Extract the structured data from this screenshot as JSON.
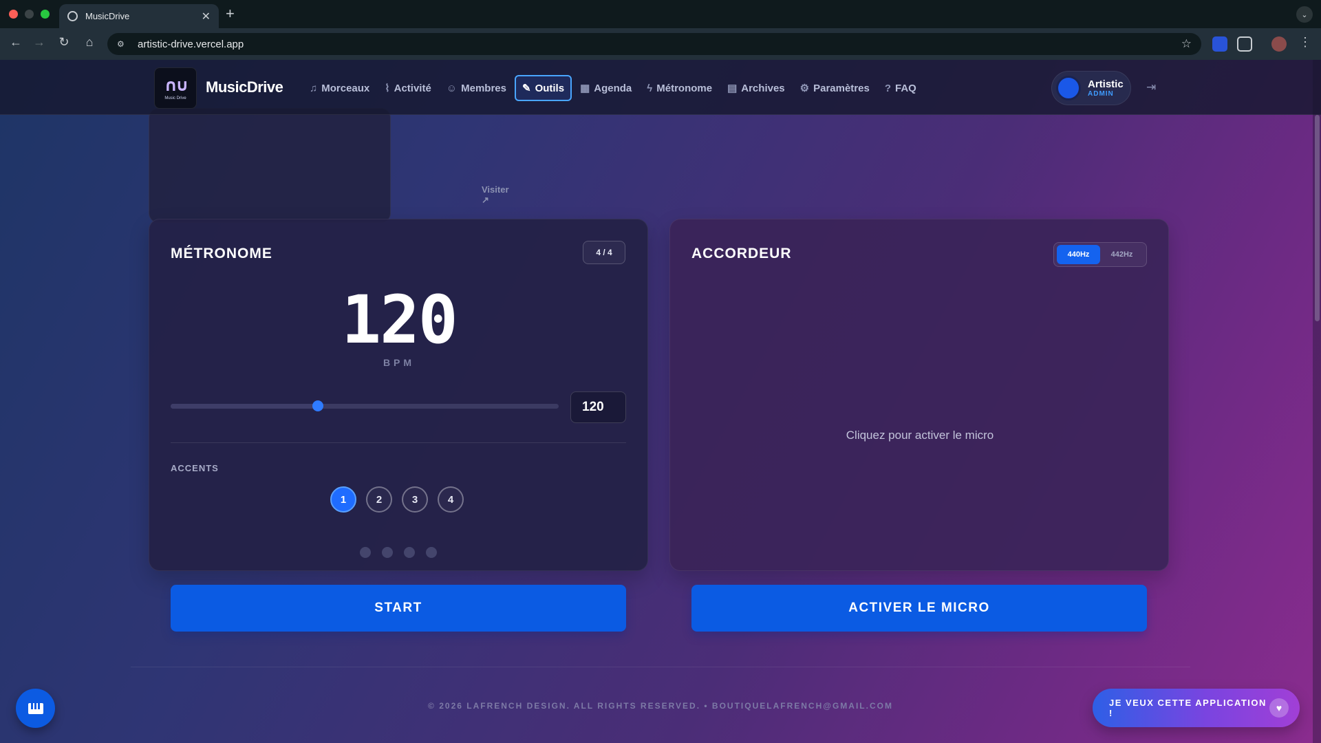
{
  "browser": {
    "tab_title": "MusicDrive",
    "url": "artistic-drive.vercel.app"
  },
  "nav": {
    "brand": "MusicDrive",
    "logo_sub": "Music Drive",
    "logo_mark": "∩∪",
    "items": [
      {
        "label": "Morceaux",
        "icon": "music-note-icon",
        "glyph": "♫"
      },
      {
        "label": "Activité",
        "icon": "activity-icon",
        "glyph": "⌇"
      },
      {
        "label": "Membres",
        "icon": "users-icon",
        "glyph": "☺"
      },
      {
        "label": "Outils",
        "icon": "wrench-icon",
        "glyph": "✎"
      },
      {
        "label": "Agenda",
        "icon": "calendar-icon",
        "glyph": "▦"
      },
      {
        "label": "Métronome",
        "icon": "zap-icon",
        "glyph": "ϟ"
      },
      {
        "label": "Archives",
        "icon": "archive-icon",
        "glyph": "▤"
      },
      {
        "label": "Paramètres",
        "icon": "gear-icon",
        "glyph": "⚙"
      },
      {
        "label": "FAQ",
        "icon": "help-circle-icon",
        "glyph": "?"
      }
    ],
    "active": "Outils",
    "user": {
      "name": "Artistic",
      "role": "ADMIN"
    }
  },
  "partial_card": {
    "visit_label": "Visiter ↗"
  },
  "metronome": {
    "title": "MÉTRONOME",
    "time_signature": "4 / 4",
    "bpm": "120",
    "bpm_unit": "BPM",
    "bpm_input": "120",
    "slider_fraction": 0.38,
    "accents_label": "ACCENTS",
    "accents": [
      "1",
      "2",
      "3",
      "4"
    ],
    "active_accent": "1",
    "beat_count": 4,
    "start_label": "START"
  },
  "tuner": {
    "title": "ACCORDEUR",
    "hz_options": [
      "440Hz",
      "442Hz"
    ],
    "hz_selected": "440Hz",
    "message": "Cliquez pour activer le micro",
    "activate_label": "ACTIVER LE MICRO"
  },
  "footer": {
    "copyright": "© 2026 LAFRENCH DESIGN. ALL RIGHTS RESERVED.  •  BOUTIQUELAFRENCH@GMAIL.COM"
  },
  "cta": {
    "label": "JE VEUX CETTE APPLICATION !"
  },
  "colors": {
    "accent": "#0b5be3",
    "active_nav_border": "#4aa6ff",
    "role": "#3f9cff"
  }
}
